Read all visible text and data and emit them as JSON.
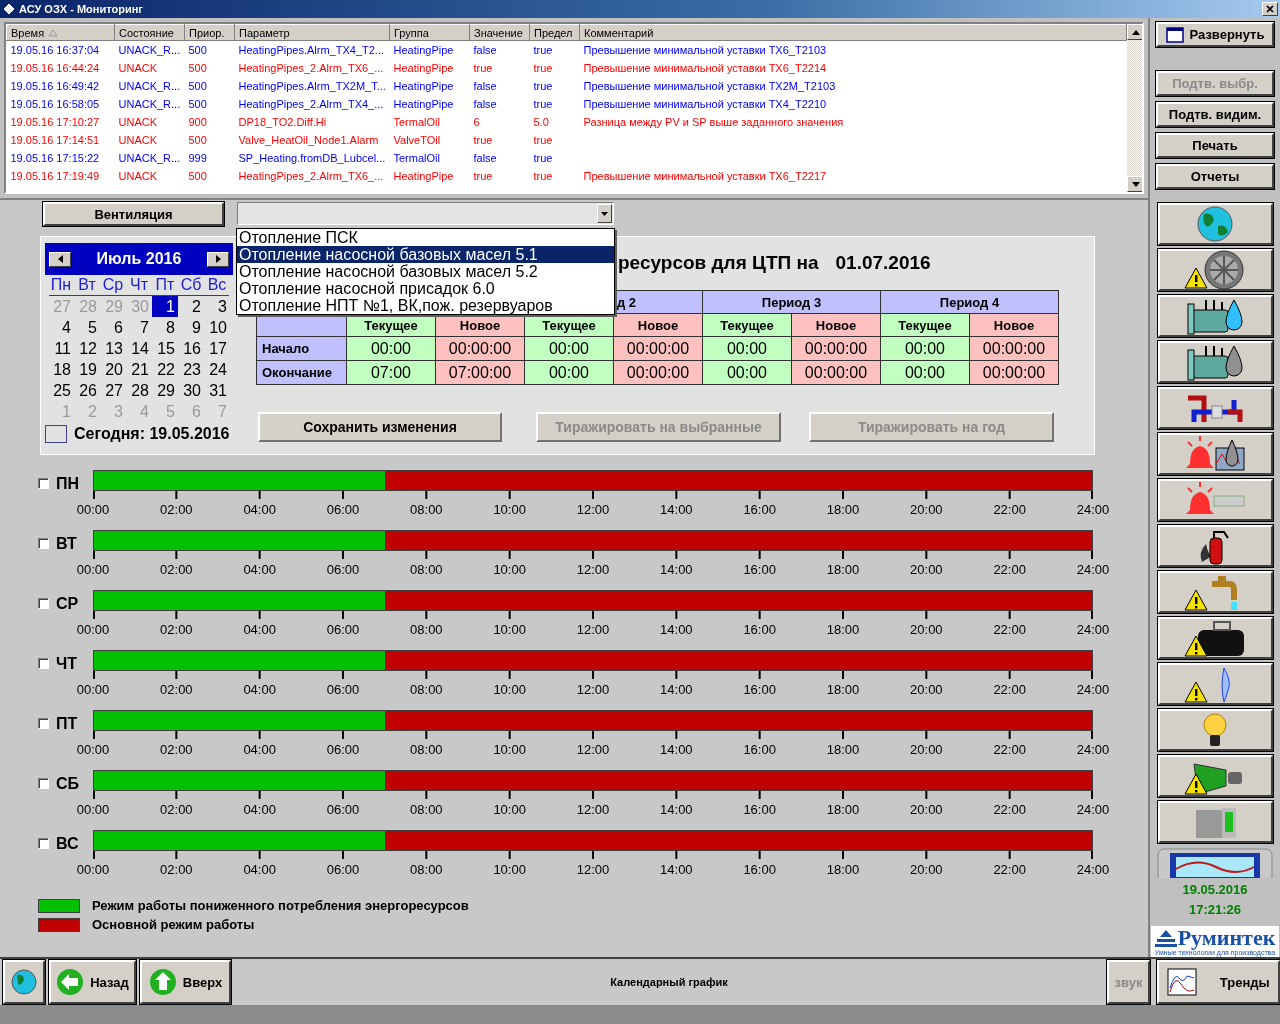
{
  "window": {
    "title": "АСУ ОЗХ - Мониторинг"
  },
  "alarms": {
    "columns": [
      {
        "label": "Время",
        "sorted": true
      },
      {
        "label": "Состояние",
        "sorted": false
      },
      {
        "label": "Приор.",
        "sorted": false
      },
      {
        "label": "Параметр",
        "sorted": false
      },
      {
        "label": "Группа",
        "sorted": false
      },
      {
        "label": "Значение",
        "sorted": false
      },
      {
        "label": "Предел",
        "sorted": false
      },
      {
        "label": "Комментарий",
        "sorted": false
      }
    ],
    "rows": [
      {
        "time": "19.05.16 16:37:04",
        "state": "UNACK_R...",
        "priority": "500",
        "parameter": "HeatingPipes.Alrm_TX4_T2...",
        "group": "HeatingPipe",
        "value": "false",
        "limit": "true",
        "comment": "Превышение минимальной уставки TX6_T2103",
        "color": "#0000ff"
      },
      {
        "time": "19.05.16 16:44:24",
        "state": "UNACK",
        "priority": "500",
        "parameter": "HeatingPipes_2.Alrm_TX6_...",
        "group": "HeatingPipe",
        "value": "true",
        "limit": "true",
        "comment": "Превышение минимальной уставки TX6_T2214",
        "color": "#ff0000"
      },
      {
        "time": "19.05.16 16:49:42",
        "state": "UNACK_R...",
        "priority": "500",
        "parameter": "HeatingPipes.Alrm_TX2M_T...",
        "group": "HeatingPipe",
        "value": "false",
        "limit": "true",
        "comment": "Превышение минимальной уставки TX2M_T2103",
        "color": "#0000ff"
      },
      {
        "time": "19.05.16 16:58:05",
        "state": "UNACK_R...",
        "priority": "500",
        "parameter": "HeatingPipes_2.Alrm_TX4_...",
        "group": "HeatingPipe",
        "value": "false",
        "limit": "true",
        "comment": "Превышение минимальной уставки TX4_T2210",
        "color": "#0000ff"
      },
      {
        "time": "19.05.16 17:10:27",
        "state": "UNACK",
        "priority": "900",
        "parameter": "DP18_TO2.Diff.Hi",
        "group": "TermalOil",
        "value": "6",
        "limit": "5.0",
        "comment": "Разница между PV и SP выше заданного значения",
        "color": "#ff0000"
      },
      {
        "time": "19.05.16 17:14:51",
        "state": "UNACK",
        "priority": "500",
        "parameter": "Valve_HeatOil_Node1.Alarm",
        "group": "ValveTOil",
        "value": "true",
        "limit": "true",
        "color": "#ff0000"
      },
      {
        "time": "19.05.16 17:15:22",
        "state": "UNACK_R...",
        "priority": "999",
        "parameter": "SP_Heating.fromDB_Lubcel...",
        "group": "TermalOil",
        "value": "false",
        "limit": "true",
        "color": "#0000ff"
      },
      {
        "time": "19.05.16 17:19:49",
        "state": "UNACK",
        "priority": "500",
        "parameter": "HeatingPipes_2.Alrm_TX6_...",
        "group": "HeatingPipe",
        "value": "true",
        "limit": "true",
        "comment": "Превышение минимальной уставки TX6_T2217",
        "color": "#ff0000"
      }
    ]
  },
  "top_buttons": [
    {
      "label": "Развернуть",
      "kind": "window",
      "disabled": false
    },
    {
      "label": "Подтв. выбр.",
      "kind": "plain",
      "disabled": true
    },
    {
      "label": "Подтв. видим.",
      "kind": "plain",
      "disabled": false
    },
    {
      "label": "Печать",
      "kind": "plain",
      "disabled": false
    },
    {
      "label": "Отчеты",
      "kind": "plain",
      "disabled": false
    }
  ],
  "group_button": "Вентиляция",
  "dropdown": {
    "expanded": true,
    "options": [
      {
        "label": "Отопление ПСК",
        "selected": false
      },
      {
        "label": "Отопление насосной базовых масел 5.1",
        "selected": true
      },
      {
        "label": "Отопление насосной базовых масел 5.2",
        "selected": false
      },
      {
        "label": "Отопление насосной присадок 6.0",
        "selected": false
      },
      {
        "label": "Отопление НПТ №1, ВК,пож. резервуаров",
        "selected": false
      }
    ]
  },
  "calendar": {
    "month": "Июль 2016",
    "weekdays": [
      "Пн",
      "Вт",
      "Ср",
      "Чт",
      "Пт",
      "Сб",
      "Вс"
    ],
    "weeks": [
      [
        {
          "day": "27",
          "other": true,
          "selected": false
        },
        {
          "day": "28",
          "other": true,
          "selected": false
        },
        {
          "day": "29",
          "other": true,
          "selected": false
        },
        {
          "day": "30",
          "other": true,
          "selected": false
        },
        {
          "day": "1",
          "other": false,
          "selected": true
        },
        {
          "day": "2",
          "other": false,
          "selected": false
        },
        {
          "day": "3",
          "other": false,
          "selected": false
        }
      ],
      [
        {
          "day": "4",
          "other": false,
          "selected": false
        },
        {
          "day": "5",
          "other": false,
          "selected": false
        },
        {
          "day": "6",
          "other": false,
          "selected": false
        },
        {
          "day": "7",
          "other": false,
          "selected": false
        },
        {
          "day": "8",
          "other": false,
          "selected": false
        },
        {
          "day": "9",
          "other": false,
          "selected": false
        },
        {
          "day": "10",
          "other": false,
          "selected": false
        }
      ],
      [
        {
          "day": "11",
          "other": false,
          "selected": false
        },
        {
          "day": "12",
          "other": false,
          "selected": false
        },
        {
          "day": "13",
          "other": false,
          "selected": false
        },
        {
          "day": "14",
          "other": false,
          "selected": false
        },
        {
          "day": "15",
          "other": false,
          "selected": false
        },
        {
          "day": "16",
          "other": false,
          "selected": false
        },
        {
          "day": "17",
          "other": false,
          "selected": false
        }
      ],
      [
        {
          "day": "18",
          "other": false,
          "selected": false
        },
        {
          "day": "19",
          "other": false,
          "selected": false
        },
        {
          "day": "20",
          "other": false,
          "selected": false
        },
        {
          "day": "21",
          "other": false,
          "selected": false
        },
        {
          "day": "22",
          "other": false,
          "selected": false
        },
        {
          "day": "23",
          "other": false,
          "selected": false
        },
        {
          "day": "24",
          "other": false,
          "selected": false
        }
      ],
      [
        {
          "day": "25",
          "other": false,
          "selected": false
        },
        {
          "day": "26",
          "other": false,
          "selected": false
        },
        {
          "day": "27",
          "other": false,
          "selected": false
        },
        {
          "day": "28",
          "other": false,
          "selected": false
        },
        {
          "day": "29",
          "other": false,
          "selected": false
        },
        {
          "day": "30",
          "other": false,
          "selected": false
        },
        {
          "day": "31",
          "other": false,
          "selected": false
        }
      ],
      [
        {
          "day": "1",
          "other": true,
          "selected": false
        },
        {
          "day": "2",
          "other": true,
          "selected": false
        },
        {
          "day": "3",
          "other": true,
          "selected": false
        },
        {
          "day": "4",
          "other": true,
          "selected": false
        },
        {
          "day": "5",
          "other": true,
          "selected": false
        },
        {
          "day": "6",
          "other": true,
          "selected": false
        },
        {
          "day": "7",
          "other": true,
          "selected": false
        }
      ]
    ],
    "today": "Сегодня: 19.05.2016"
  },
  "schedule": {
    "title": "ресурсов для ЦТП на",
    "date": "01.07.2016",
    "row_labels": [
      "Начало",
      "Окончание"
    ],
    "periods": [
      {
        "sub": [
          "Текущее",
          "Новое"
        ],
        "start": [
          "00:00",
          "00:00:00"
        ],
        "end": [
          "07:00",
          "07:00:00"
        ]
      },
      {
        "label": "д 2",
        "sub": [
          "Текущее",
          "Новое"
        ],
        "start": [
          "00:00",
          "00:00:00"
        ],
        "end": [
          "00:00",
          "00:00:00"
        ]
      },
      {
        "label": "Период 3",
        "sub": [
          "Текущее",
          "Новое"
        ],
        "start": [
          "00:00",
          "00:00:00"
        ],
        "end": [
          "00:00",
          "00:00:00"
        ]
      },
      {
        "label": "Период 4",
        "sub": [
          "Текущее",
          "Новое"
        ],
        "start": [
          "00:00",
          "00:00:00"
        ],
        "end": [
          "00:00",
          "00:00:00"
        ]
      }
    ]
  },
  "actions": [
    {
      "label": "Сохранить изменения",
      "disabled": false
    },
    {
      "label": "Тиражировать на выбранные",
      "disabled": true
    },
    {
      "label": "Тиражировать на год",
      "disabled": true
    }
  ],
  "days": [
    {
      "label": "ПН",
      "checked": false,
      "level": 0.2917,
      "ticks": [
        "00:00",
        "02:00",
        "04:00",
        "06:00",
        "08:00",
        "10:00",
        "12:00",
        "14:00",
        "16:00",
        "18:00",
        "20:00",
        "22:00",
        "24:00"
      ]
    },
    {
      "label": "ВТ",
      "checked": false,
      "level": 0.2917,
      "ticks": [
        "00:00",
        "02:00",
        "04:00",
        "06:00",
        "08:00",
        "10:00",
        "12:00",
        "14:00",
        "16:00",
        "18:00",
        "20:00",
        "22:00",
        "24:00"
      ]
    },
    {
      "label": "СР",
      "checked": false,
      "level": 0.2917,
      "ticks": [
        "00:00",
        "02:00",
        "04:00",
        "06:00",
        "08:00",
        "10:00",
        "12:00",
        "14:00",
        "16:00",
        "18:00",
        "20:00",
        "22:00",
        "24:00"
      ]
    },
    {
      "label": "ЧТ",
      "checked": false,
      "level": 0.2917,
      "ticks": [
        "00:00",
        "02:00",
        "04:00",
        "06:00",
        "08:00",
        "10:00",
        "12:00",
        "14:00",
        "16:00",
        "18:00",
        "20:00",
        "22:00",
        "24:00"
      ]
    },
    {
      "label": "ПТ",
      "checked": false,
      "level": 0.2917,
      "ticks": [
        "00:00",
        "02:00",
        "04:00",
        "06:00",
        "08:00",
        "10:00",
        "12:00",
        "14:00",
        "16:00",
        "18:00",
        "20:00",
        "22:00",
        "24:00"
      ]
    },
    {
      "label": "СБ",
      "checked": false,
      "level": 0.2917,
      "ticks": [
        "00:00",
        "02:00",
        "04:00",
        "06:00",
        "08:00",
        "10:00",
        "12:00",
        "14:00",
        "16:00",
        "18:00",
        "20:00",
        "22:00",
        "24:00"
      ]
    },
    {
      "label": "ВС",
      "checked": false,
      "level": 0.2917,
      "ticks": [
        "00:00",
        "02:00",
        "04:00",
        "06:00",
        "08:00",
        "10:00",
        "12:00",
        "14:00",
        "16:00",
        "18:00",
        "20:00",
        "22:00",
        "24:00"
      ]
    }
  ],
  "legend": [
    {
      "label": "Режим работы пониженного потребления энергоресурсов",
      "color": "#00c000"
    },
    {
      "label": "Основной режим работы",
      "color": "#c00000"
    }
  ],
  "sidebar": {
    "buttons": [
      {
        "kind": "globe"
      },
      {
        "kind": "warning-fan"
      },
      {
        "kind": "tank-water"
      },
      {
        "kind": "tank-oil"
      },
      {
        "kind": "pipe-valve"
      },
      {
        "kind": "alarm-oil"
      },
      {
        "kind": "alarm-pipe"
      },
      {
        "kind": "extinguisher"
      },
      {
        "kind": "warning-faucet"
      },
      {
        "kind": "warning-tank"
      },
      {
        "kind": "warning-flame"
      },
      {
        "kind": "bulb"
      },
      {
        "kind": "warning-motor"
      },
      {
        "kind": "cabinet"
      }
    ],
    "date": "19.05.2016",
    "time": "17:21:26",
    "logo": "Руминтек",
    "tagline": "Умные технологии для производства"
  },
  "bottom_bar": {
    "buttons": [
      {
        "kind": "globe"
      },
      {
        "kind": "back",
        "label": "Назад"
      },
      {
        "kind": "up",
        "label": "Вверх"
      }
    ],
    "title": "Календарный график",
    "sound": {
      "label": "звук",
      "disabled": true
    },
    "trends": {
      "label": "Тренды"
    }
  }
}
